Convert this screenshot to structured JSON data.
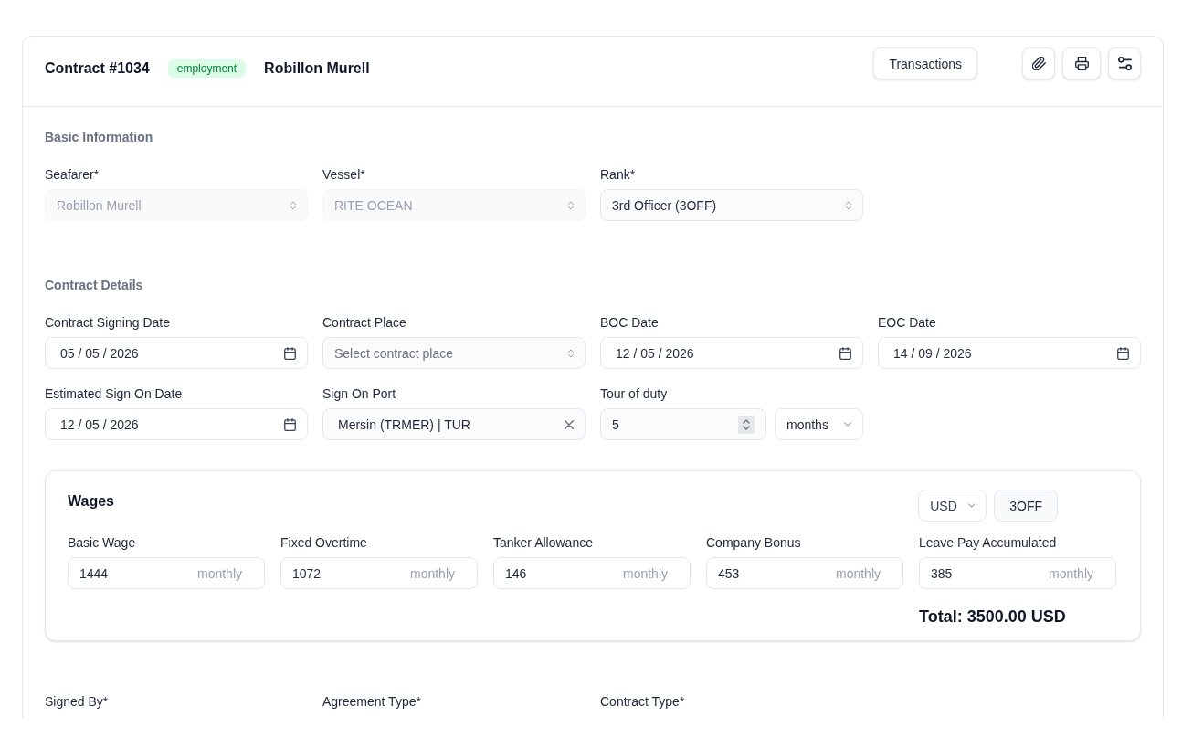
{
  "header": {
    "title": "Contract #1034",
    "badge": "employment",
    "name": "Robillon Murell",
    "action": "Transactions"
  },
  "sections": [
    {
      "title": "Basic Information",
      "fields": [
        {
          "label": "Seafarer*",
          "kind": "select",
          "value": "Robillon Murell",
          "disabled": true
        },
        {
          "label": "Vessel*",
          "kind": "select",
          "value": "RITE OCEAN",
          "disabled": true
        },
        {
          "label": "Rank*",
          "kind": "select",
          "value": "3rd Officer (3OFF)",
          "disabled": false
        }
      ]
    },
    {
      "title": "Contract Details",
      "fields": [
        {
          "label": "Contract Signing Date",
          "kind": "date",
          "value": "05 / 05 / 2026",
          "disabled": false
        },
        {
          "label": "Contract Place",
          "kind": "select",
          "placeholder": "Select contract place",
          "disabled": false
        },
        {
          "label": "BOC Date",
          "kind": "date",
          "value": "12 / 05 / 2026",
          "disabled": false
        },
        {
          "label": "EOC Date",
          "kind": "date",
          "value": "14 / 09 / 2026",
          "disabled": false
        },
        {
          "label": "Estimated Sign On Date",
          "kind": "date",
          "value": "12 / 05 / 2026",
          "disabled": false
        },
        {
          "label": "Sign On Port",
          "kind": "combobox",
          "value": "Mersin (TRMER) | TUR",
          "disabled": false
        },
        {
          "label": "Tour of duty",
          "kind": "duration",
          "value": "5",
          "unit": "months",
          "disabled": false
        }
      ]
    }
  ],
  "wages": {
    "title": "Wages",
    "currency": "USD",
    "rank_button": "3OFF",
    "items": [
      {
        "label": "Basic Wage",
        "value": "1444",
        "period": "monthly"
      },
      {
        "label": "Fixed Overtime",
        "value": "1072",
        "period": "monthly"
      },
      {
        "label": "Tanker Allowance",
        "value": "146",
        "period": "monthly"
      },
      {
        "label": "Company Bonus",
        "value": "453",
        "period": "monthly"
      },
      {
        "label": "Leave Pay Accumulated",
        "value": "385",
        "period": "monthly"
      }
    ],
    "total": "Total: 3500.00 USD"
  },
  "next_fields": [
    {
      "label": "Signed By*"
    },
    {
      "label": "Agreement Type*"
    },
    {
      "label": "Contract Type*"
    }
  ]
}
